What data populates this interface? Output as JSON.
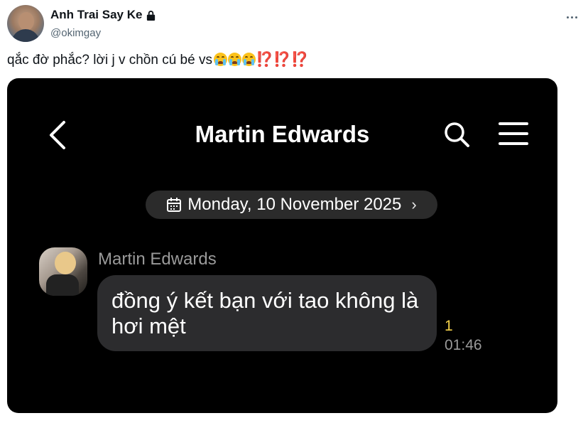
{
  "post": {
    "author_name": "Anh Trai Say Ke",
    "author_handle": "@okimgay",
    "text": "qắc đờ phắc? lời j v chồn cú bé vs",
    "emoji": [
      "loudly-crying-face",
      "loudly-crying-face",
      "loudly-crying-face"
    ],
    "interrobangs": [
      "⁉️",
      "⁉️",
      "⁉️"
    ],
    "accent_color": "#e0245e"
  },
  "chat": {
    "title": "Martin Edwards",
    "date": "Monday, 10 November 2025",
    "message": {
      "sender": "Martin Edwards",
      "text_line1": "đồng ý kết bạn với tao không là",
      "text_line2": "hơi mệt",
      "read_count": "1",
      "time": "01:46"
    },
    "colors": {
      "background": "#000000",
      "bubble": "#2c2c2e",
      "read_count": "#f5d24a"
    }
  }
}
